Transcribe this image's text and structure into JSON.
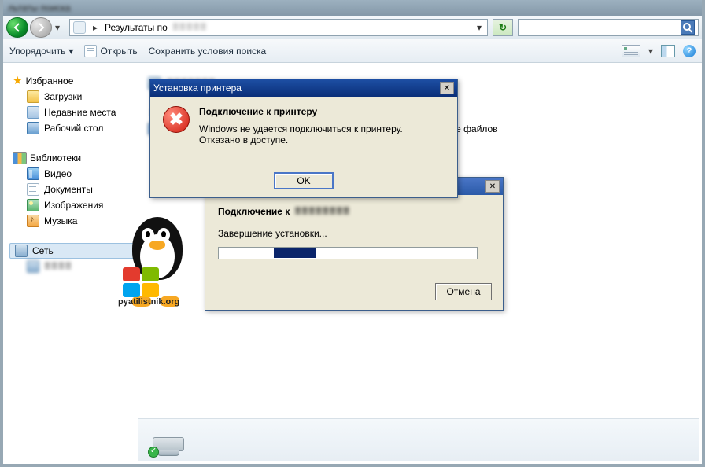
{
  "window": {
    "title": "льтаты поиска"
  },
  "nav": {
    "breadcrumb": "Результаты по",
    "search_value": "",
    "search_placeholder": ""
  },
  "toolbar": {
    "organize": "Упорядочить",
    "open": "Открыть",
    "save_search": "Сохранить условия поиска"
  },
  "sidebar": {
    "favorites": {
      "label": "Избранное",
      "items": [
        {
          "label": "Загрузки"
        },
        {
          "label": "Недавние места"
        },
        {
          "label": "Рабочий стол"
        }
      ]
    },
    "libraries": {
      "label": "Библиотеки",
      "items": [
        {
          "label": "Видео"
        },
        {
          "label": "Документы"
        },
        {
          "label": "Изображения"
        },
        {
          "label": "Музыка"
        }
      ]
    },
    "network": {
      "label": "Сеть"
    }
  },
  "main": {
    "search_again_label": "Пов",
    "content_hint": "держимое файлов"
  },
  "progress_dialog": {
    "title": "",
    "connect_label": "Подключение к",
    "status": "Завершение установки...",
    "cancel": "Отмена"
  },
  "error_dialog": {
    "title": "Установка принтера",
    "heading": "Подключение к принтеру",
    "line1": "Windows не удается подключиться к принтеру.",
    "line2": "Отказано в доступе.",
    "ok": "OK"
  },
  "status": {
    "item_label": ""
  },
  "watermark": "pyatilistnik.org"
}
